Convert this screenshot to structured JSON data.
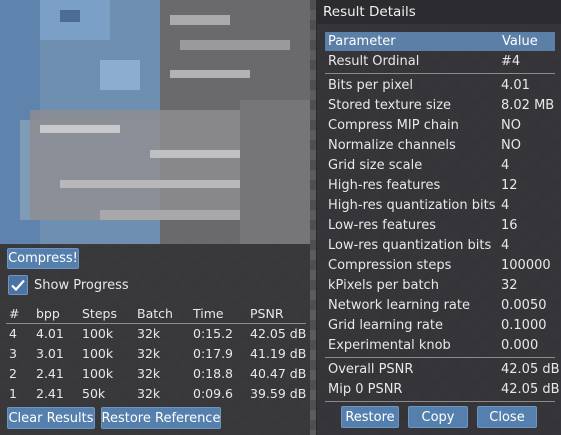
{
  "left": {
    "compress_button": "Compress!",
    "show_progress_label": "Show Progress",
    "show_progress_checked": true,
    "results_headers": [
      "#",
      "bpp",
      "Steps",
      "Batch",
      "Time",
      "PSNR"
    ],
    "results_rows": [
      [
        "4",
        "4.01",
        "100k",
        "32k",
        "0:15.2",
        "42.05 dB"
      ],
      [
        "3",
        "3.01",
        "100k",
        "32k",
        "0:17.9",
        "41.19 dB"
      ],
      [
        "2",
        "2.41",
        "100k",
        "32k",
        "0:18.8",
        "40.47 dB"
      ],
      [
        "1",
        "2.41",
        "50k",
        "32k",
        "0:09.6",
        "39.59 dB"
      ]
    ],
    "clear_button": "Clear Results",
    "restore_reference_button": "Restore Reference"
  },
  "details": {
    "title": "Result Details",
    "col_parameter": "Parameter",
    "col_value": "Value",
    "ordinal_label": "Result Ordinal",
    "ordinal_value": "#4",
    "params": [
      {
        "p": "Bits per pixel",
        "v": "4.01"
      },
      {
        "p": "Stored texture size",
        "v": "8.02 MB"
      },
      {
        "p": "Compress MIP chain",
        "v": "NO"
      },
      {
        "p": "Normalize channels",
        "v": "NO"
      },
      {
        "p": "Grid size scale",
        "v": "4"
      },
      {
        "p": "High-res features",
        "v": "12"
      },
      {
        "p": "High-res quantization bits",
        "v": "4"
      },
      {
        "p": "Low-res features",
        "v": "16"
      },
      {
        "p": "Low-res quantization bits",
        "v": "4"
      },
      {
        "p": "Compression steps",
        "v": "100000"
      },
      {
        "p": "kPixels per batch",
        "v": "32"
      },
      {
        "p": "Network learning rate",
        "v": "0.0050"
      },
      {
        "p": "Grid learning rate",
        "v": "0.1000"
      },
      {
        "p": "Experimental knob",
        "v": "0.000"
      }
    ],
    "overall_psnr_label": "Overall PSNR",
    "overall_psnr_value": "42.05 dB",
    "mip0_psnr_label": "Mip 0 PSNR",
    "mip0_psnr_value": "42.05 dB",
    "restore_button": "Restore",
    "copy_button": "Copy",
    "close_button": "Close"
  },
  "colors": {
    "accent": "#5580ad",
    "header_highlight": "#5c7fa8",
    "checker_light": "#5c5c5c",
    "checker_dark": "#4f4f4f"
  }
}
